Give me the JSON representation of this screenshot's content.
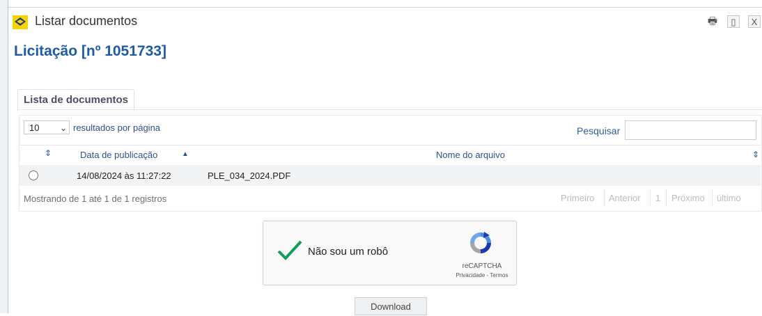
{
  "window": {
    "title": "Listar documentos",
    "buttons": {
      "print": "🖶",
      "maximize": "▯",
      "close": "X"
    }
  },
  "page_title": "Licitação [nº 1051733]",
  "tab": {
    "label": "Lista de documentos"
  },
  "controls": {
    "page_size": "10",
    "results_label": "resultados por página",
    "search_label": "Pesquisar",
    "search_value": ""
  },
  "table": {
    "headers": {
      "date": "Data de publicação",
      "file": "Nome do arquivo"
    },
    "rows": [
      {
        "date": "14/08/2024 às 11:27:22",
        "file": "PLE_034_2024.PDF"
      }
    ]
  },
  "footer": {
    "info": "Mostrando de 1 até 1 de 1 registros",
    "pagination": {
      "first": "Primeiro",
      "prev": "Anterior",
      "page": "1",
      "next": "Próximo",
      "last": "último"
    }
  },
  "captcha": {
    "label": "Não sou um robô",
    "brand": "reCAPTCHA",
    "links": "Privacidade - Termos"
  },
  "download_label": "Download",
  "colors": {
    "accent": "#1f5aa8",
    "link": "#2c4f8f",
    "muted": "#b8bdc3",
    "row_bg": "#f2f3f5"
  }
}
